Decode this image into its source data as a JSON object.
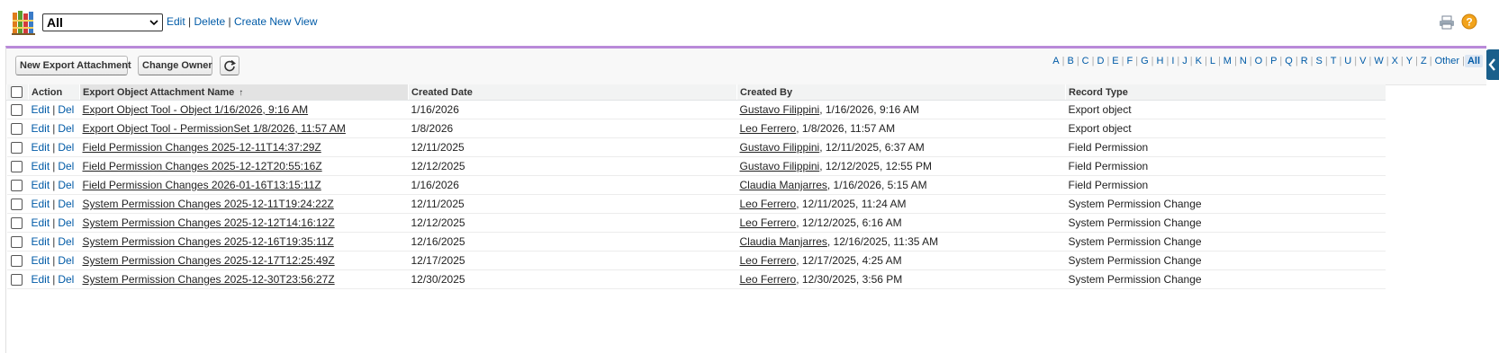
{
  "view": {
    "selected": "All",
    "edit_label": "Edit",
    "delete_label": "Delete",
    "create_label": "Create New View",
    "separator": "|"
  },
  "toolbar": {
    "new_button": "New Export Attachment",
    "owner_button": "Change Owner"
  },
  "alpha": [
    "A",
    "B",
    "C",
    "D",
    "E",
    "F",
    "G",
    "H",
    "I",
    "J",
    "K",
    "L",
    "M",
    "N",
    "O",
    "P",
    "Q",
    "R",
    "S",
    "T",
    "U",
    "V",
    "W",
    "X",
    "Y",
    "Z",
    "Other",
    "All"
  ],
  "alpha_active": "All",
  "columns": {
    "action": "Action",
    "name": "Export Object Attachment Name",
    "sort_arrow": "↑",
    "created_date": "Created Date",
    "created_by": "Created By",
    "record_type": "Record Type"
  },
  "actions": {
    "edit": "Edit",
    "del": "Del",
    "sep": "|"
  },
  "rows": [
    {
      "name": "Export Object Tool - Object 1/16/2026, 9:16 AM",
      "date": "1/16/2026",
      "user": "Gustavo Filippini",
      "stamp": ", 1/16/2026, 9:16 AM",
      "type": "Export object"
    },
    {
      "name": "Export Object Tool - PermissionSet 1/8/2026, 11:57 AM",
      "date": "1/8/2026",
      "user": "Leo Ferrero",
      "stamp": ", 1/8/2026, 11:57 AM",
      "type": "Export object"
    },
    {
      "name": "Field Permission Changes 2025-12-11T14:37:29Z",
      "date": "12/11/2025",
      "user": "Gustavo Filippini",
      "stamp": ", 12/11/2025, 6:37 AM",
      "type": "Field Permission"
    },
    {
      "name": "Field Permission Changes 2025-12-12T20:55:16Z",
      "date": "12/12/2025",
      "user": "Gustavo Filippini",
      "stamp": ", 12/12/2025, 12:55 PM",
      "type": "Field Permission"
    },
    {
      "name": "Field Permission Changes 2026-01-16T13:15:11Z",
      "date": "1/16/2026",
      "user": "Claudia Manjarres",
      "stamp": ", 1/16/2026, 5:15 AM",
      "type": "Field Permission"
    },
    {
      "name": "System Permission Changes 2025-12-11T19:24:22Z",
      "date": "12/11/2025",
      "user": "Leo Ferrero",
      "stamp": ", 12/11/2025, 11:24 AM",
      "type": "System Permission Change"
    },
    {
      "name": "System Permission Changes 2025-12-12T14:16:12Z",
      "date": "12/12/2025",
      "user": "Leo Ferrero",
      "stamp": ", 12/12/2025, 6:16 AM",
      "type": "System Permission Change"
    },
    {
      "name": "System Permission Changes 2025-12-16T19:35:11Z",
      "date": "12/16/2025",
      "user": "Claudia Manjarres",
      "stamp": ", 12/16/2025, 11:35 AM",
      "type": "System Permission Change"
    },
    {
      "name": "System Permission Changes 2025-12-17T12:25:49Z",
      "date": "12/17/2025",
      "user": "Leo Ferrero",
      "stamp": ", 12/17/2025, 4:25 AM",
      "type": "System Permission Change"
    },
    {
      "name": "System Permission Changes 2025-12-30T23:56:27Z",
      "date": "12/30/2025",
      "user": "Leo Ferrero",
      "stamp": ", 12/30/2025, 3:56 PM",
      "type": "System Permission Change"
    }
  ]
}
